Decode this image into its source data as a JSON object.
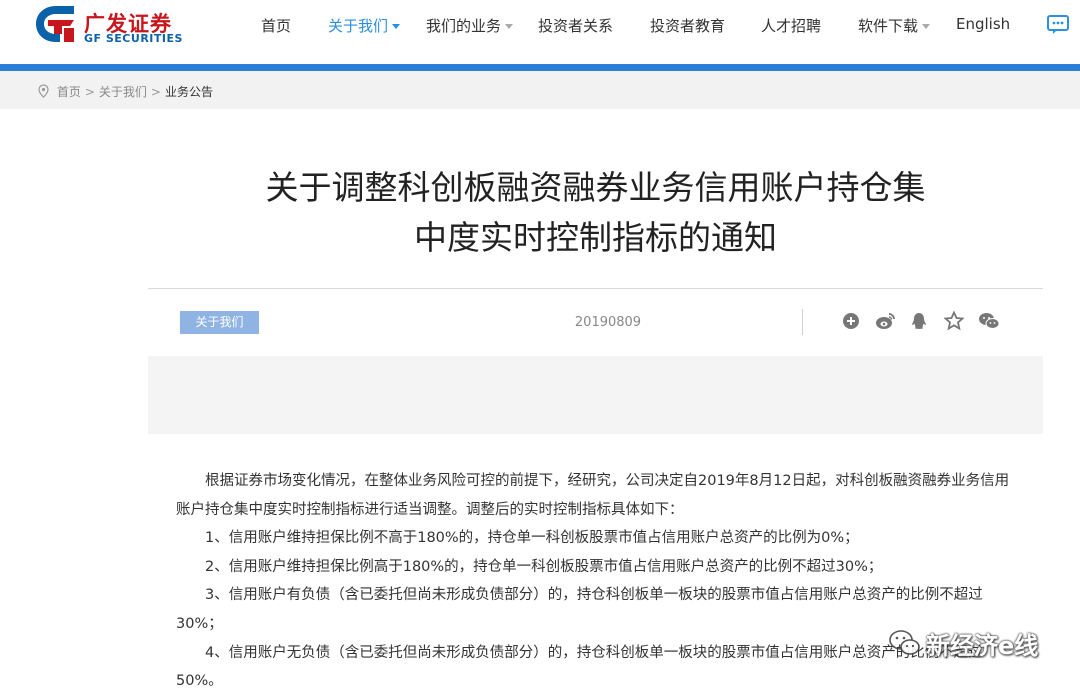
{
  "brand": {
    "name_cn": "广发证券",
    "name_en": "GF SECURITIES",
    "colors": {
      "primary_red": "#c8161d",
      "primary_blue": "#0b62a8",
      "nav_active": "#2d8fe0",
      "bar_blue": "#2b7fd8"
    }
  },
  "nav": {
    "items": [
      {
        "label": "首页",
        "active": false,
        "dropdown": false
      },
      {
        "label": "关于我们",
        "active": true,
        "dropdown": true
      },
      {
        "label": "我们的业务",
        "active": false,
        "dropdown": true
      },
      {
        "label": "投资者关系",
        "active": false,
        "dropdown": false
      },
      {
        "label": "投资者教育",
        "active": false,
        "dropdown": false
      },
      {
        "label": "人才招聘",
        "active": false,
        "dropdown": false
      },
      {
        "label": "软件下载",
        "active": false,
        "dropdown": true
      },
      {
        "label": "English",
        "active": false,
        "dropdown": false
      }
    ],
    "message_icon": "chat-bubble-icon"
  },
  "breadcrumb": {
    "items": [
      "首页",
      "关于我们",
      "业务公告"
    ],
    "separator": ">"
  },
  "article": {
    "title_line1": "关于调整科创板融资融券业务信用账户持仓集",
    "title_line2": "中度实时控制指标的通知",
    "category": "关于我们",
    "date": "20190809",
    "share_icons": [
      "plus-circle-icon",
      "weibo-icon",
      "qq-icon",
      "star-icon",
      "wechat-icon"
    ],
    "paragraphs": [
      "根据证券市场变化情况，在整体业务风险可控的前提下，经研究，公司决定自2019年8月12日起，对科创板融资融券业务信用账户持仓集中度实时控制指标进行适当调整。调整后的实时控制指标具体如下：",
      "1、信用账户维持担保比例不高于180%的，持仓单一科创板股票市值占信用账户总资产的比例为0%；",
      "2、信用账户维持担保比例高于180%的，持仓单一科创板股票市值占信用账户总资产的比例不超过30%；",
      "3、信用账户有负债（含已委托但尚未形成负债部分）的，持仓科创板单一板块的股票市值占信用账户总资产的比例不超过30%；",
      "4、信用账户无负债（含已委托但尚未形成负债部分）的，持仓科创板单一板块的股票市值占信用账户总资产的比例不超过50%。"
    ]
  },
  "watermark": {
    "text": "新经济e线",
    "icon": "wechat-logo-icon"
  }
}
